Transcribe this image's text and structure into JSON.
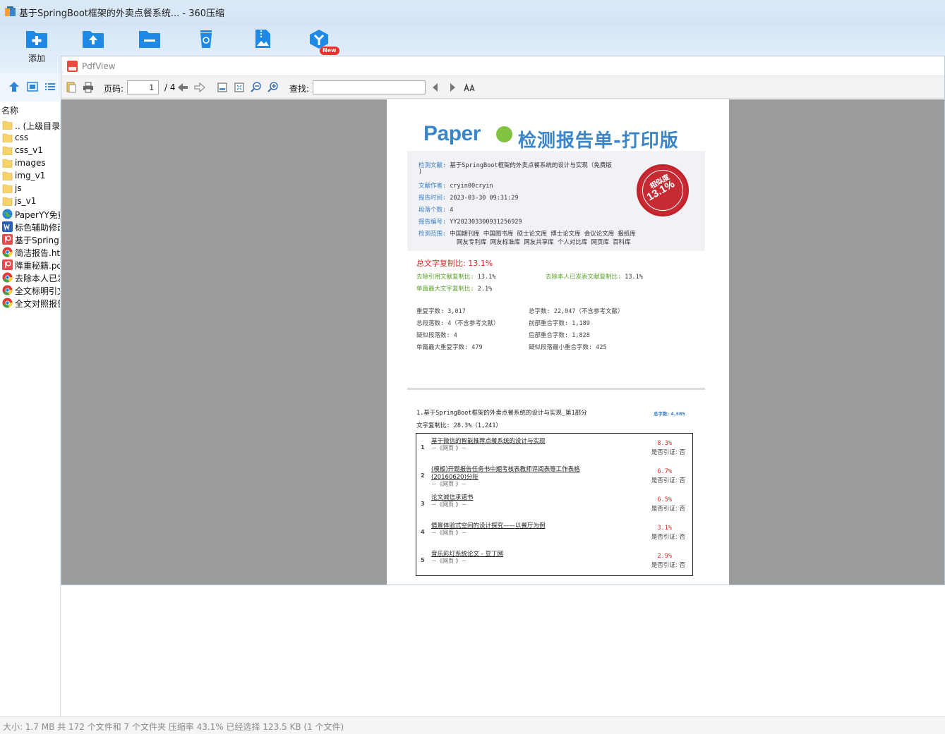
{
  "window": {
    "title": "基于SpringBoot框架的外卖点餐系统... - 360压缩"
  },
  "toolbar": {
    "buttons": [
      {
        "id": "add",
        "label": "添加",
        "icon": "add-folder-icon"
      },
      {
        "id": "extract",
        "label": "",
        "icon": "extract-folder-icon"
      },
      {
        "id": "compress",
        "label": "",
        "icon": "compress-folder-icon"
      },
      {
        "id": "delete",
        "label": "",
        "icon": "recycle-bin-icon"
      },
      {
        "id": "image",
        "label": "",
        "icon": "zip-image-icon"
      },
      {
        "id": "new-tool",
        "label": "",
        "icon": "y-box-icon"
      }
    ],
    "new_badge": "New"
  },
  "filelist": {
    "header": "名称",
    "items": [
      {
        "name": ".. (上级目录)",
        "type": "folder"
      },
      {
        "name": "css",
        "type": "folder"
      },
      {
        "name": "css_v1",
        "type": "folder"
      },
      {
        "name": "images",
        "type": "folder"
      },
      {
        "name": "img_v1",
        "type": "folder"
      },
      {
        "name": "js",
        "type": "folder"
      },
      {
        "name": "js_v1",
        "type": "folder"
      },
      {
        "name": "PaperYY免费",
        "type": "web"
      },
      {
        "name": "标色辅助修改",
        "type": "word"
      },
      {
        "name": "基于Spring",
        "type": "pdf"
      },
      {
        "name": "简洁报告.htm",
        "type": "chrome"
      },
      {
        "name": "降重秘籍.pdf",
        "type": "pdf"
      },
      {
        "name": "去除本人已发",
        "type": "chrome"
      },
      {
        "name": "全文标明引文",
        "type": "chrome"
      },
      {
        "name": "全文对照报告",
        "type": "chrome"
      }
    ]
  },
  "pdfview": {
    "title": "PdfView",
    "page_label": "页码:",
    "page_current": "1",
    "page_total": "/ 4",
    "find_label": "查找:"
  },
  "report": {
    "logo": "Paper",
    "title": "检测报告单-打印版",
    "doc_key": "检测文献:",
    "doc_val": "基于SpringBoot框架的外卖点餐系统的设计与实现（免费版",
    "doc_val2": ")",
    "author_key": "文献作者:",
    "author_val": "cryin00cryin",
    "time_key": "报告时间:",
    "time_val": "2023-03-30 09:31:29",
    "paras_key": "段落个数:",
    "paras_val": "4",
    "id_key": "报告编号:",
    "id_val": "YY202303300931256929",
    "scope_key": "检测范围:",
    "scope_val1": "中国期刊库 中国图书库 硕士论文库 博士论文库 会议论文库 报纸库",
    "scope_val2": "网友专利库 网友标准库 网友共享库 个人对比库 网页库 百科库",
    "stamp_title": "相似度",
    "stamp_value": "13.1%",
    "total_label": "总文字复制比: 13.1%",
    "exclude_ref_label": "去除引用文献复制比:",
    "exclude_ref_value": "13.1%",
    "exclude_self_label": "去除本人已发表文献复制比:",
    "exclude_self_value": "13.1%",
    "max_single_label": "单篇最大文字复制比:",
    "max_single_value": "2.1%",
    "stats": [
      "重复字数: 3,017",
      "总字数: 22,947（不含参考文献）",
      "总段落数: 4（不含参考文献）",
      "前部重合字数: 1,189",
      "疑似段落数: 4",
      "后部重合字数: 1,828",
      "单篇最大重复字数: 479",
      "疑似段落最小重合字数: 425"
    ],
    "section_title": "1.基于SpringBoot框架的外卖点餐系统的设计与实现_第1部分",
    "section_total": "总字数: 4,385",
    "section_ratio": "文字复制比: 28.3%（1,241）",
    "sources": [
      {
        "num": "1",
        "title": "基于微信的智能推荐点餐系统的设计与实现",
        "title2": "",
        "src": "－《网页 》－",
        "pct": "8.3%",
        "cite": "是否引证: 否"
      },
      {
        "num": "2",
        "title": "(模板)开题报告任务书中期考核表教师评阅表等工作表格",
        "title2": "(20160620)分析",
        "src": "－《网页 》－",
        "pct": "6.7%",
        "cite": "是否引证: 否"
      },
      {
        "num": "3",
        "title": "论文诚信承诺书",
        "title2": "",
        "src": "－《网页 》－",
        "pct": "6.5%",
        "cite": "是否引证: 否"
      },
      {
        "num": "4",
        "title": "情景体验式空间的设计探究——以餐厅为例",
        "title2": "",
        "src": "－《网页 》－",
        "pct": "3.1%",
        "cite": "是否引证: 否"
      },
      {
        "num": "5",
        "title": "音乐彩灯系统论文 - 豆丁网",
        "title2": "",
        "src": "－《网页 》－",
        "pct": "2.9%",
        "cite": "是否引证: 否"
      }
    ]
  },
  "statusbar": {
    "text": "大小: 1.7 MB 共 172 个文件和 7 个文件夹 压缩率 43.1% 已经选择 123.5 KB (1 个文件)"
  },
  "colors": {
    "accent": "#1e88e5",
    "report_blue": "#3a86c9",
    "report_red": "#e22222",
    "report_green": "#5aa02c"
  }
}
